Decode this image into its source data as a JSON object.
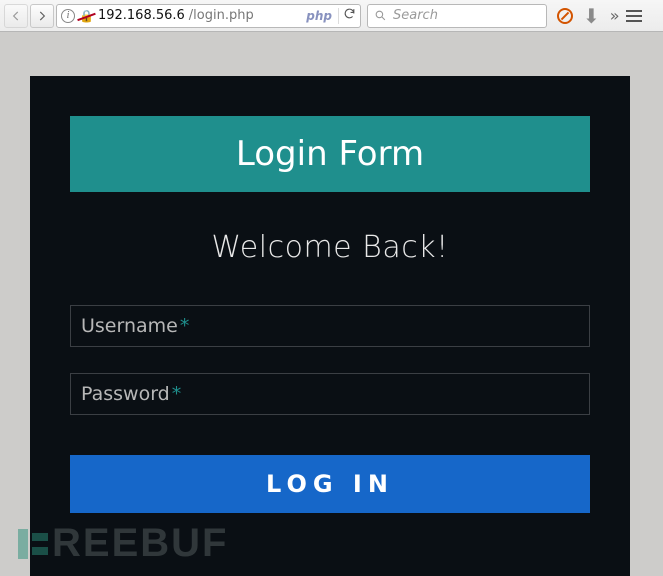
{
  "toolbar": {
    "url_ip": "192.168.56.6",
    "url_path": "/login.php",
    "php_badge": "php",
    "search_placeholder": "Search"
  },
  "login": {
    "header": "Login Form",
    "welcome": "Welcome Back!",
    "username_label": "Username",
    "password_label": "Password",
    "asterisk": "*",
    "button": "LOG IN"
  },
  "watermark": "REEBUF"
}
